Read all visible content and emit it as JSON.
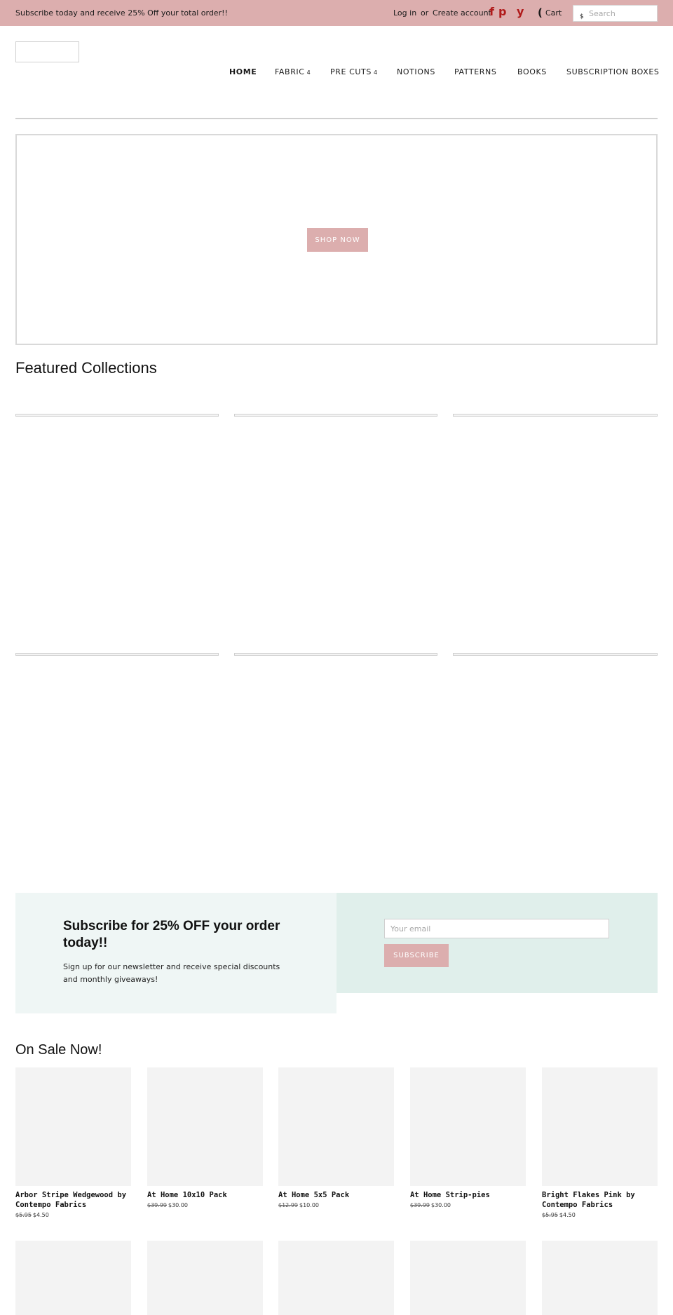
{
  "topbar": {
    "promo": "Subscribe today and receive 25% Off your total order!!",
    "login": "Log in",
    "or": "or",
    "create_account": "Create account",
    "social": {
      "facebook": "f",
      "pinterest": "p",
      "youtube": "y"
    },
    "cart_icon": "(",
    "cart": "Cart",
    "search_icon": "$",
    "search_placeholder": "Search"
  },
  "nav": {
    "items": [
      {
        "label": "HOME",
        "caret": ""
      },
      {
        "label": "FABRIC",
        "caret": "4"
      },
      {
        "label": "PRE CUTS",
        "caret": "4"
      },
      {
        "label": "NOTIONS",
        "caret": ""
      },
      {
        "label": "PATTERNS",
        "caret": ""
      },
      {
        "label": "BOOKS",
        "caret": ""
      },
      {
        "label": "SUBSCRIPTION BOXES",
        "caret": ""
      }
    ]
  },
  "hero": {
    "button": "SHOP NOW"
  },
  "featured": {
    "title": "Featured Collections"
  },
  "subscribe": {
    "title": "Subscribe for 25% OFF your order today!!",
    "text": "Sign up for our newsletter and receive special discounts and monthly giveaways!",
    "email_placeholder": "Your email",
    "button": "SUBSCRIBE"
  },
  "sale": {
    "title": "On Sale Now!",
    "products": [
      {
        "name": "Arbor Stripe Wedgewood by Contempo Fabrics",
        "old_price": "$5.95",
        "price": "$4.50"
      },
      {
        "name": "At Home 10x10 Pack",
        "old_price": "$39.99",
        "price": "$30.00"
      },
      {
        "name": "At Home 5x5 Pack",
        "old_price": "$12.99",
        "price": "$10.00"
      },
      {
        "name": "At Home Strip-pies",
        "old_price": "$39.99",
        "price": "$30.00"
      },
      {
        "name": "Bright Flakes Pink by Contempo Fabrics",
        "old_price": "$5.95",
        "price": "$4.50"
      }
    ]
  },
  "colors": {
    "accent": "#dcaeae",
    "social": "#b01a1a",
    "sub_left_bg": "#eff6f5",
    "sub_right_bg": "#e0efeb",
    "product_placeholder": "#f3f3f3"
  }
}
